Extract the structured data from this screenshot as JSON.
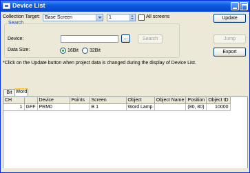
{
  "window": {
    "title": "Device List"
  },
  "collection": {
    "label": "Collection Target:",
    "target_value": "Base Screen",
    "screen_number": "1",
    "all_screens_label": "All screens"
  },
  "search": {
    "group_title": "Search",
    "device_label": "Device:",
    "device_value": "",
    "browse_label": "...",
    "search_button": "Search",
    "data_size_label": "Data Size:",
    "size_16bit": "16Bit",
    "size_32bit": "32Bit",
    "selected_size": "16Bit"
  },
  "buttons": {
    "update": "Update",
    "jump": "Jump",
    "export": "Export"
  },
  "notice": "*Click on the Update button when project data is changed during the display of Device List.",
  "tabs": [
    {
      "label": "Bit"
    },
    {
      "label": "Word"
    }
  ],
  "active_tab": "Word",
  "table": {
    "columns": [
      "CH",
      "",
      "Device",
      "Points",
      "Screen",
      "Object",
      "Object Name",
      "Position",
      "Object ID"
    ],
    "rows": [
      {
        "ch": "1",
        "flag": "GFF",
        "device": "PRM0",
        "points": "",
        "screen": "B 1",
        "object": "Word Lamp",
        "object_name": "",
        "position": "(80, 80)",
        "object_id": "10000"
      }
    ]
  }
}
